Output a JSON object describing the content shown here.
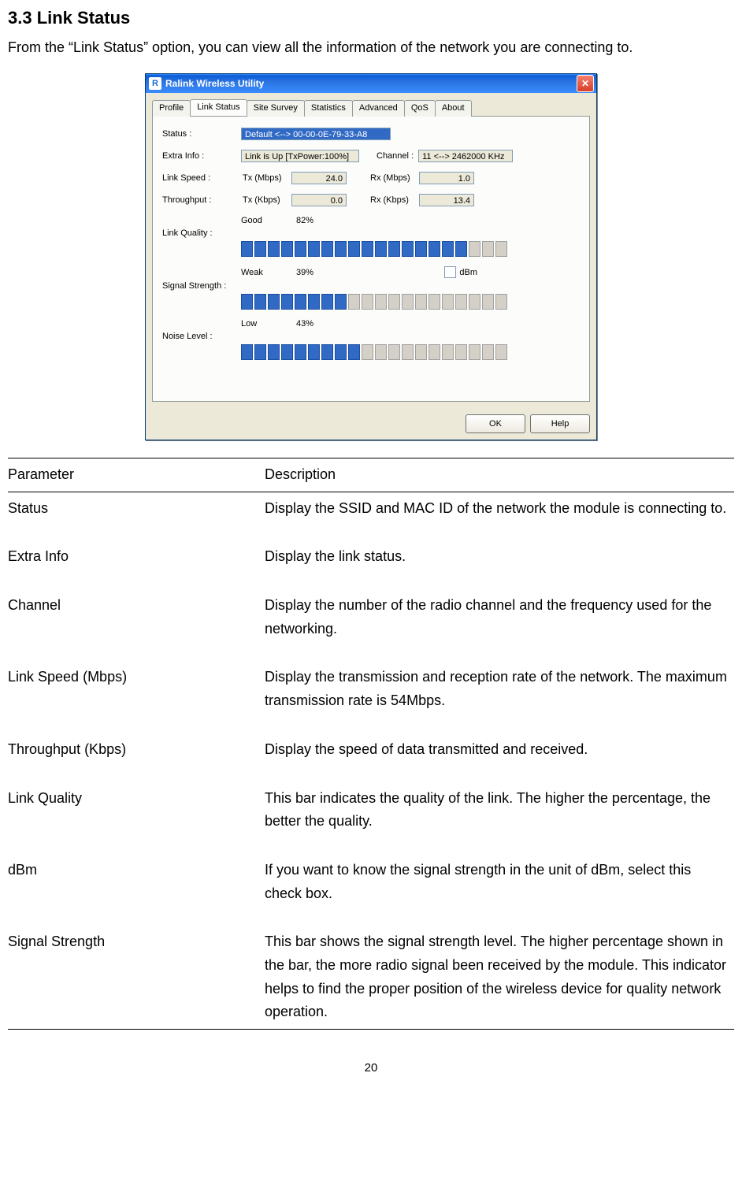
{
  "heading": "3.3   Link Status",
  "intro": "From the “Link Status” option, you can view all the information of the network you are connecting to.",
  "page_number": "20",
  "window": {
    "title": "Ralink Wireless Utility",
    "icon_letter": "R",
    "tabs": [
      "Profile",
      "Link Status",
      "Site Survey",
      "Statistics",
      "Advanced",
      "QoS",
      "About"
    ],
    "active_tab_index": 1,
    "status_label": "Status :",
    "status_value": "Default <--> 00-00-0E-79-33-A8",
    "extra_label": "Extra Info :",
    "extra_value": "Link is Up [TxPower:100%]",
    "channel_label": "Channel :",
    "channel_value": "11 <--> 2462000 KHz",
    "linkspeed_label": "Link Speed :",
    "tx_mbps_label": "Tx (Mbps)",
    "tx_mbps_value": "24.0",
    "rx_mbps_label": "Rx (Mbps)",
    "rx_mbps_value": "1.0",
    "throughput_label": "Throughput :",
    "tx_kbps_label": "Tx (Kbps)",
    "tx_kbps_value": "0.0",
    "rx_kbps_label": "Rx (Kbps)",
    "rx_kbps_value": "13.4",
    "quality_label": "Link Quality :",
    "quality_word": "Good",
    "quality_pct": "82%",
    "quality_filled": 17,
    "quality_total": 20,
    "signal_label": "Signal Strength :",
    "signal_word": "Weak",
    "signal_pct": "39%",
    "signal_filled": 8,
    "signal_total": 20,
    "dbm_label": "dBm",
    "noise_label": "Noise Level :",
    "noise_word": "Low",
    "noise_pct": "43%",
    "noise_filled": 9,
    "noise_total": 20,
    "ok_button": "OK",
    "help_button": "Help"
  },
  "table": {
    "header_param": "Parameter",
    "header_desc": "Description",
    "rows": [
      {
        "param": "Status",
        "desc": "Display the SSID and MAC ID of the network the module is connecting to."
      },
      {
        "param": "Extra Info",
        "desc": "Display the link status."
      },
      {
        "param": "Channel",
        "desc": "Display the number of the radio channel and the frequency used for the networking."
      },
      {
        "param": "Link Speed (Mbps)",
        "desc": "Display the transmission and reception rate of the network. The maximum transmission rate is 54Mbps."
      },
      {
        "param": "Throughput (Kbps)",
        "desc": "Display the speed of data transmitted and received."
      },
      {
        "param": "Link Quality",
        "desc": "This bar indicates the quality of the link. The higher the percentage, the better the quality."
      },
      {
        "param": "dBm",
        "desc": "If you want to know the signal strength in the unit of dBm, select this check box."
      },
      {
        "param": "Signal Strength",
        "desc": "This bar shows the signal strength level. The higher percentage shown in the bar, the more radio signal been received by the module. This indicator helps to find the proper position of the wireless device for quality network operation."
      }
    ]
  }
}
